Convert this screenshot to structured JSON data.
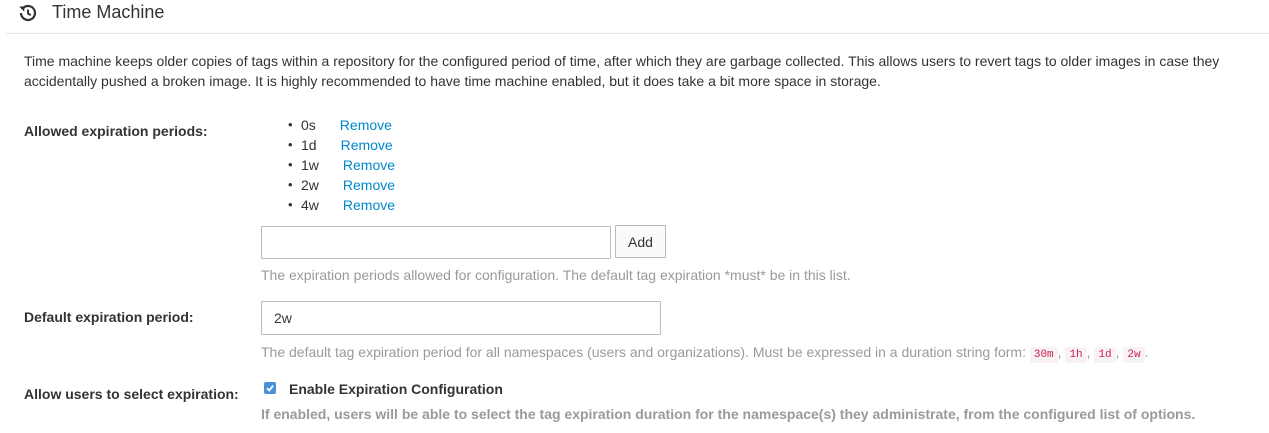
{
  "header": {
    "title": "Time Machine",
    "icon": "history-icon"
  },
  "description": "Time machine keeps older copies of tags within a repository for the configured period of time, after which they are garbage collected. This allows users to revert tags to older images in case they accidentally pushed a broken image. It is highly recommended to have time machine enabled, but it does take a bit more space in storage.",
  "allowed_periods": {
    "label": "Allowed expiration periods:",
    "items": [
      {
        "value": "0s",
        "remove_label": "Remove"
      },
      {
        "value": "1d",
        "remove_label": "Remove"
      },
      {
        "value": "1w",
        "remove_label": "Remove"
      },
      {
        "value": "2w",
        "remove_label": "Remove"
      },
      {
        "value": "4w",
        "remove_label": "Remove"
      }
    ],
    "new_period_value": "",
    "add_label": "Add",
    "help": "The expiration periods allowed for configuration. The default tag expiration *must* be in this list."
  },
  "default_period": {
    "label": "Default expiration period:",
    "value": "2w",
    "help_prefix": "The default tag expiration period for all namespaces (users and organizations). Must be expressed in a duration string form:",
    "examples": [
      "30m",
      "1h",
      "1d",
      "2w"
    ],
    "sep1": ",",
    "sep2": ",",
    "sep3": ",",
    "end": "."
  },
  "allow_select": {
    "label": "Allow users to select expiration:",
    "checkbox_checked": true,
    "checkbox_label": "Enable Expiration Configuration",
    "help": "If enabled, users will be able to select the tag expiration duration for the namespace(s) they administrate, from the configured list of options."
  },
  "colors": {
    "link": "#0088ce",
    "checkbox": "#4a90d9",
    "code_text": "#c7254e",
    "code_bg": "#f9f2f4"
  }
}
